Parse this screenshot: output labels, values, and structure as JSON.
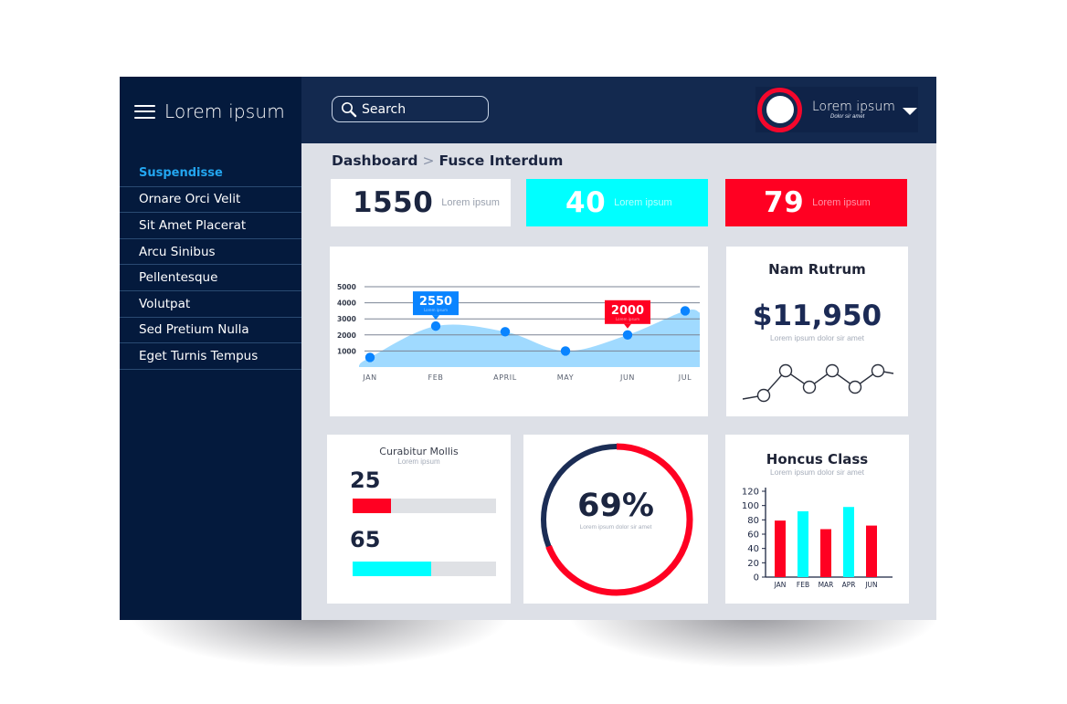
{
  "sidebar": {
    "brand_title": "Lorem ipsum",
    "menu_icon": "hamburger-menu-icon",
    "items": [
      {
        "label": "Suspendisse",
        "active": true
      },
      {
        "label": "Ornare Orci Velit",
        "active": false
      },
      {
        "label": "Sit Amet Placerat",
        "active": false
      },
      {
        "label": "Arcu Sinibus",
        "active": false
      },
      {
        "label": "Pellentesque",
        "active": false
      },
      {
        "label": "Volutpat",
        "active": false
      },
      {
        "label": "Sed Pretium Nulla",
        "active": false
      },
      {
        "label": "Eget Turnis Tempus",
        "active": false
      }
    ]
  },
  "topbar": {
    "search_placeholder": "Search",
    "search_icon": "magnifier-icon",
    "user": {
      "name": "Lorem ipsum",
      "subtitle": "Dolor sir amet",
      "dropdown_icon": "caret-down-icon"
    }
  },
  "breadcrumb": {
    "items": [
      "Dashboard",
      "Fusce Interdum"
    ],
    "separator": ">"
  },
  "kpis": [
    {
      "value": "1550",
      "label": "Lorem ipsum",
      "color": "#ffffff"
    },
    {
      "value": "40",
      "label": "Lorem ipsum",
      "color": "#00ffff"
    },
    {
      "value": "79",
      "label": "Lorem ipsum",
      "color": "#ff0022"
    }
  ],
  "revenue_card": {
    "title": "Nam Rutrum",
    "value": "$11,950",
    "subtitle": "Lorem ipsum dolor sir amet",
    "sparkline": [
      2,
      1,
      4,
      2,
      4,
      2,
      4
    ]
  },
  "progress_card": {
    "title": "Curabitur Mollis",
    "subtitle": "Lorem ipsum",
    "bars": [
      {
        "value": "25",
        "fraction": 0.27,
        "color": "#ff0022"
      },
      {
        "value": "65",
        "fraction": 0.55,
        "color": "#00ffff"
      }
    ]
  },
  "donut_card": {
    "value": "69%",
    "percent": 69,
    "subtitle": "Lorem ipsum dolor sir amet",
    "colors": {
      "filled": "#ff0022",
      "rest": "#1b2d55"
    }
  },
  "chart_data": [
    {
      "type": "area",
      "title": "",
      "xlabel": "",
      "ylabel": "",
      "categories": [
        "JAN",
        "FEB",
        "APRIL",
        "MAY",
        "JUN",
        "JUL"
      ],
      "values": [
        600,
        2550,
        2200,
        1000,
        2000,
        3500
      ],
      "yticks": [
        1000,
        2000,
        3000,
        4000,
        5000
      ],
      "ylim": [
        0,
        5000
      ],
      "grid": true,
      "annotations": [
        {
          "category": "FEB",
          "label": "2550",
          "sublabel": "Lorem ipsum",
          "color": "#0a84ff"
        },
        {
          "category": "JUN",
          "label": "2000",
          "sublabel": "Lorem ipsum",
          "color": "#ff0022"
        }
      ],
      "colors": {
        "area": "#8fd3ff",
        "points": "#0a84ff"
      }
    },
    {
      "type": "bar",
      "title": "Honcus Class",
      "subtitle": "Lorem ipsum dolor sir amet",
      "categories": [
        "JAN",
        "FEB",
        "MAR",
        "APR",
        "JUN"
      ],
      "values": [
        79,
        92,
        67,
        98,
        72
      ],
      "colors": [
        "#ff0022",
        "#00ffff",
        "#ff0022",
        "#00ffff",
        "#ff0022"
      ],
      "yticks": [
        0,
        20,
        40,
        60,
        80,
        100,
        120
      ],
      "ylim": [
        0,
        120
      ],
      "grid": false
    }
  ]
}
